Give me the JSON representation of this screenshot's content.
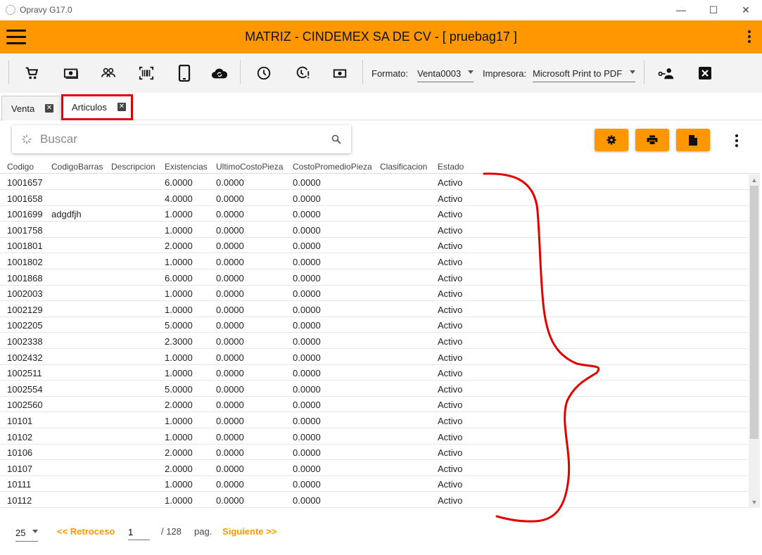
{
  "window": {
    "title": "Opravy G17.0",
    "controls": [
      "—",
      "☐",
      "✕"
    ]
  },
  "header": {
    "title": "MATRIZ - CINDEMEX SA DE CV - [ pruebag17 ]"
  },
  "toolbar": {
    "formato_label": "Formato:",
    "formato_value": "Venta0003",
    "impresora_label": "Impresora:",
    "impresora_value": "Microsoft Print to PDF"
  },
  "tabs": [
    {
      "label": "Venta"
    },
    {
      "label": "Articulos"
    }
  ],
  "search": {
    "placeholder": "Buscar"
  },
  "table": {
    "columns": [
      "Codigo",
      "CodigoBarras",
      "Descripcion",
      "Existencias",
      "UltimoCostoPieza",
      "CostoPromedioPieza",
      "Clasificacion",
      "Estado"
    ],
    "rows": [
      [
        "1001657",
        "",
        "",
        "6.0000",
        "0.0000",
        "0.0000",
        "",
        "Activo"
      ],
      [
        "1001658",
        "",
        "",
        "4.0000",
        "0.0000",
        "0.0000",
        "",
        "Activo"
      ],
      [
        "1001699",
        "adgdfjh",
        "",
        "1.0000",
        "0.0000",
        "0.0000",
        "",
        "Activo"
      ],
      [
        "1001758",
        "",
        "",
        "1.0000",
        "0.0000",
        "0.0000",
        "",
        "Activo"
      ],
      [
        "1001801",
        "",
        "",
        "2.0000",
        "0.0000",
        "0.0000",
        "",
        "Activo"
      ],
      [
        "1001802",
        "",
        "",
        "1.0000",
        "0.0000",
        "0.0000",
        "",
        "Activo"
      ],
      [
        "1001868",
        "",
        "",
        "6.0000",
        "0.0000",
        "0.0000",
        "",
        "Activo"
      ],
      [
        "1002003",
        "",
        "",
        "1.0000",
        "0.0000",
        "0.0000",
        "",
        "Activo"
      ],
      [
        "1002129",
        "",
        "",
        "1.0000",
        "0.0000",
        "0.0000",
        "",
        "Activo"
      ],
      [
        "1002205",
        "",
        "",
        "5.0000",
        "0.0000",
        "0.0000",
        "",
        "Activo"
      ],
      [
        "1002338",
        "",
        "",
        "2.3000",
        "0.0000",
        "0.0000",
        "",
        "Activo"
      ],
      [
        "1002432",
        "",
        "",
        "1.0000",
        "0.0000",
        "0.0000",
        "",
        "Activo"
      ],
      [
        "1002511",
        "",
        "",
        "1.0000",
        "0.0000",
        "0.0000",
        "",
        "Activo"
      ],
      [
        "1002554",
        "",
        "",
        "5.0000",
        "0.0000",
        "0.0000",
        "",
        "Activo"
      ],
      [
        "1002560",
        "",
        "",
        "2.0000",
        "0.0000",
        "0.0000",
        "",
        "Activo"
      ],
      [
        "10101",
        "",
        "",
        "1.0000",
        "0.0000",
        "0.0000",
        "",
        "Activo"
      ],
      [
        "10102",
        "",
        "",
        "1.0000",
        "0.0000",
        "0.0000",
        "",
        "Activo"
      ],
      [
        "10106",
        "",
        "",
        "2.0000",
        "0.0000",
        "0.0000",
        "",
        "Activo"
      ],
      [
        "10107",
        "",
        "",
        "2.0000",
        "0.0000",
        "0.0000",
        "",
        "Activo"
      ],
      [
        "10111",
        "",
        "",
        "1.0000",
        "0.0000",
        "0.0000",
        "",
        "Activo"
      ],
      [
        "10112",
        "",
        "",
        "1.0000",
        "0.0000",
        "0.0000",
        "",
        "Activo"
      ]
    ]
  },
  "pager": {
    "page_size": "25",
    "prev_label": "<<  Retroceso",
    "current_page": "1",
    "total_pages": "/  128",
    "pag_label": "pag.",
    "next_label": "Siguiente  >>"
  },
  "colors": {
    "accent": "#ff9800",
    "annotation": "#e00000"
  }
}
